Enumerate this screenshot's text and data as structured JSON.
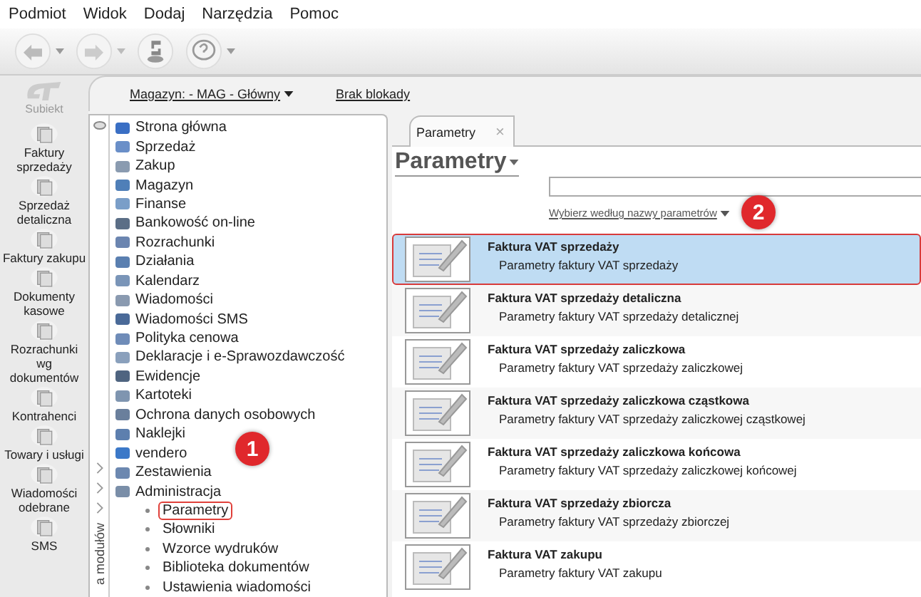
{
  "menu": [
    "Podmiot",
    "Widok",
    "Dodaj",
    "Narzędzia",
    "Pomoc"
  ],
  "logo": {
    "text": "Subiekt"
  },
  "nav": [
    {
      "label": "Faktury sprzedaży"
    },
    {
      "label": "Sprzedaż detaliczna"
    },
    {
      "label": "Faktury zakupu"
    },
    {
      "label": "Dokumenty kasowe"
    },
    {
      "label": "Rozrachunki wg dokumentów"
    },
    {
      "label": "Kontrahenci"
    },
    {
      "label": "Towary i usługi"
    },
    {
      "label": "Wiadomości odebrane"
    },
    {
      "label": "SMS"
    }
  ],
  "top_links": [
    "Magazyn: - MAG - Główny",
    "Brak blokady"
  ],
  "module_panel": {
    "vertical_label": "a modułów",
    "items": [
      {
        "label": "Strona główna",
        "color": "#3a6fc4"
      },
      {
        "label": "Sprzedaż",
        "color": "#6a8fc8"
      },
      {
        "label": "Zakup",
        "color": "#8a9bb0"
      },
      {
        "label": "Magazyn",
        "color": "#4f7fb8"
      },
      {
        "label": "Finanse",
        "color": "#7a9ec8"
      },
      {
        "label": "Bankowość on-line",
        "color": "#5b6e86"
      },
      {
        "label": "Rozrachunki",
        "color": "#6b85b0"
      },
      {
        "label": "Działania",
        "color": "#5a7fb0"
      },
      {
        "label": "Kalendarz",
        "color": "#7a95b8"
      },
      {
        "label": "Wiadomości",
        "color": "#8a9ab0"
      },
      {
        "label": "Wiadomości SMS",
        "color": "#4a6a98"
      },
      {
        "label": "Polityka cenowa",
        "color": "#6f8cb8"
      },
      {
        "label": "Deklaracje i e-Sprawozdawczość",
        "color": "#8aa0bc"
      },
      {
        "label": "Ewidencje",
        "color": "#4f6480"
      },
      {
        "label": "Kartoteki",
        "color": "#7f95b0"
      },
      {
        "label": "Ochrona danych osobowych",
        "color": "#6a7f9c"
      },
      {
        "label": "Naklejki",
        "color": "#5d7fae"
      },
      {
        "label": "vendero",
        "color": "#3b78c8"
      },
      {
        "label": "Zestawienia",
        "color": "#6c88b0"
      },
      {
        "label": "Administracja",
        "color": "#7a8ea8",
        "children": [
          {
            "label": "Parametry",
            "selected": true
          },
          {
            "label": "Słowniki",
            "selected": false
          },
          {
            "label": "Wzorce wydruków",
            "selected": false
          },
          {
            "label": "Biblioteka dokumentów",
            "selected": false
          },
          {
            "label": "Ustawienia wiadomości",
            "selected": false
          }
        ]
      }
    ]
  },
  "tab": {
    "label": "Parametry",
    "close": "×"
  },
  "page_title": "Parametry",
  "filter_link": "Wybierz według nazwy parametrów",
  "rows": [
    {
      "title": "Faktura VAT sprzedaży",
      "subtitle": "Parametry faktury VAT sprzedaży",
      "selected": true
    },
    {
      "title": "Faktura VAT sprzedaży detaliczna",
      "subtitle": "Parametry faktury VAT sprzedaży detalicznej",
      "selected": false
    },
    {
      "title": "Faktura VAT sprzedaży zaliczkowa",
      "subtitle": "Parametry faktury VAT sprzedaży zaliczkowej",
      "selected": false
    },
    {
      "title": "Faktura VAT sprzedaży zaliczkowa cząstkowa",
      "subtitle": "Parametry faktury VAT sprzedaży zaliczkowej cząstkowej",
      "selected": false
    },
    {
      "title": "Faktura VAT sprzedaży zaliczkowa końcowa",
      "subtitle": "Parametry faktury VAT sprzedaży zaliczkowej końcowej",
      "selected": false
    },
    {
      "title": "Faktura VAT sprzedaży zbiorcza",
      "subtitle": "Parametry faktury VAT sprzedaży zbiorczej",
      "selected": false
    },
    {
      "title": "Faktura VAT zakupu",
      "subtitle": "Parametry faktury VAT zakupu",
      "selected": false
    }
  ],
  "callouts": [
    "1",
    "2"
  ]
}
